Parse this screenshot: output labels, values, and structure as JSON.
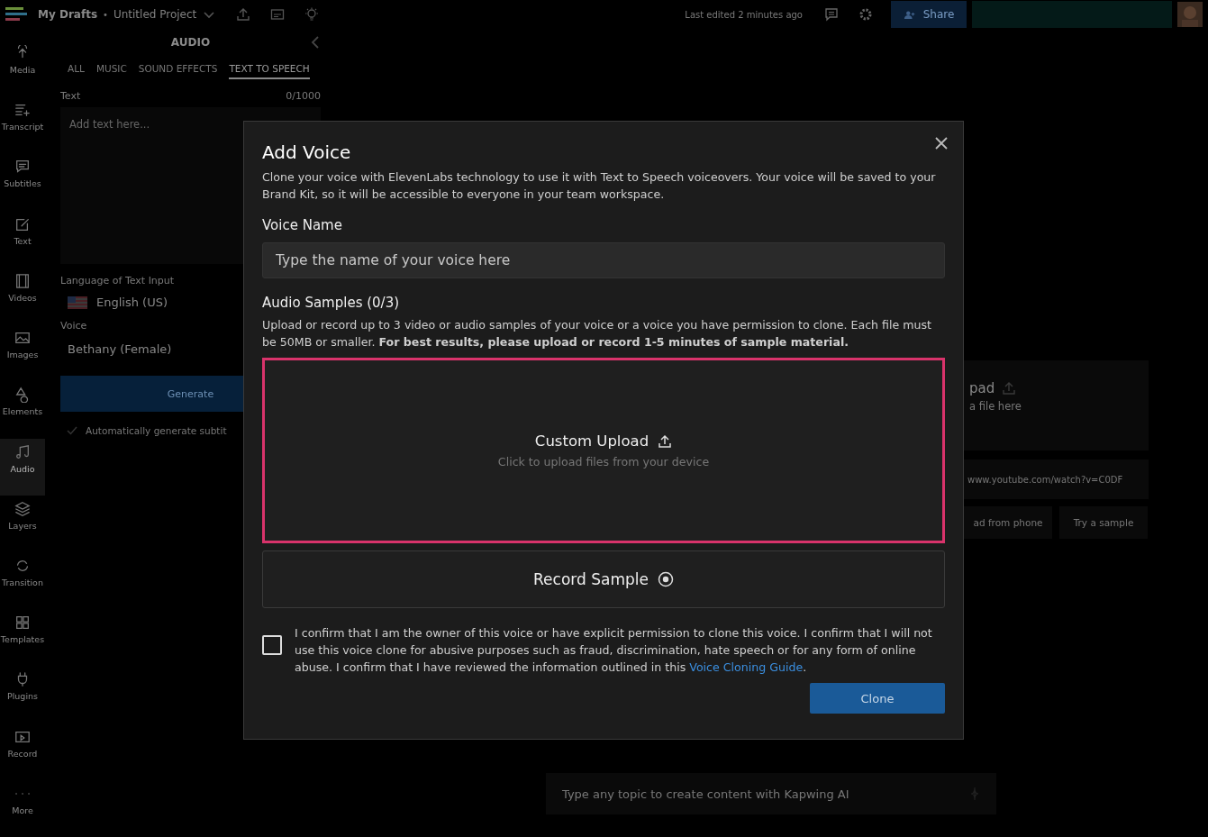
{
  "top_bar": {
    "breadcrumb": "My Drafts",
    "separator": "•",
    "project_title": "Untitled Project",
    "last_edited": "Last edited 2 minutes ago",
    "share_button": "Share"
  },
  "sidebar": {
    "items": [
      {
        "label": "Media",
        "selected": false
      },
      {
        "label": "Transcript",
        "selected": false
      },
      {
        "label": "Subtitles",
        "selected": false
      },
      {
        "label": "Text",
        "selected": false
      },
      {
        "label": "Videos",
        "selected": false
      },
      {
        "label": "Images",
        "selected": false
      },
      {
        "label": "Elements",
        "selected": false
      },
      {
        "label": "Audio",
        "selected": true
      },
      {
        "label": "Layers",
        "selected": false
      },
      {
        "label": "Transition",
        "selected": false
      },
      {
        "label": "Templates",
        "selected": false
      },
      {
        "label": "Plugins",
        "selected": false
      },
      {
        "label": "Record",
        "selected": false
      },
      {
        "label": "More",
        "selected": false
      }
    ]
  },
  "audio_panel": {
    "title": "AUDIO",
    "tabs": [
      {
        "label": "ALL",
        "selected": false
      },
      {
        "label": "MUSIC",
        "selected": false
      },
      {
        "label": "SOUND EFFECTS",
        "selected": false
      },
      {
        "label": "TEXT TO SPEECH",
        "selected": true
      }
    ],
    "text_label": "Text",
    "counter": "0/1000",
    "text_placeholder": "Add text here...",
    "language_label": "Language of Text Input",
    "language": "English (US)",
    "voice_label": "Voice",
    "voice": "Bethany (Female)",
    "generate_button": "Generate",
    "auto_subtitles": {
      "label": "Automatically generate subtit",
      "checked": true
    }
  },
  "workspace": {
    "upload_title": "pad",
    "upload_hint": "a file here",
    "url_placeholder": "www.youtube.com/watch?v=C0DF",
    "phone_button": "ad from phone",
    "sample_button": "Try a sample",
    "ai_placeholder": "Type any topic to create content with Kapwing AI"
  },
  "dialog": {
    "title": "Add Voice",
    "description": "Clone your voice with ElevenLabs technology to use it with Text to Speech voiceovers. Your voice will be saved to your Brand Kit, so it will be accessible to everyone in your team workspace.",
    "voice_name_label": "Voice Name",
    "voice_name_placeholder": "Type the name of your voice here",
    "samples_label": "Audio Samples (0/3)",
    "samples_description": "Upload or record up to 3 video or audio samples of your voice or a voice you have permission to clone. Each file must be 50MB or smaller. **For best results, please upload or record 1-5 minutes of sample material.**",
    "upload_zone": {
      "title": "Custom Upload",
      "hint": "Click to upload files from your device",
      "highlighted": true
    },
    "record_button": "Record Sample",
    "consent": {
      "checked": false,
      "text": "I confirm that I am the owner of this voice or have explicit permission to clone this voice. I confirm that I will not use this voice clone for abusive purposes such as fraud, discrimination, hate speech or for any form of online abuse. I confirm that I have reviewed the information outlined in this",
      "link": "Voice Cloning Guide",
      "end": "."
    },
    "clone_button": "Clone"
  }
}
